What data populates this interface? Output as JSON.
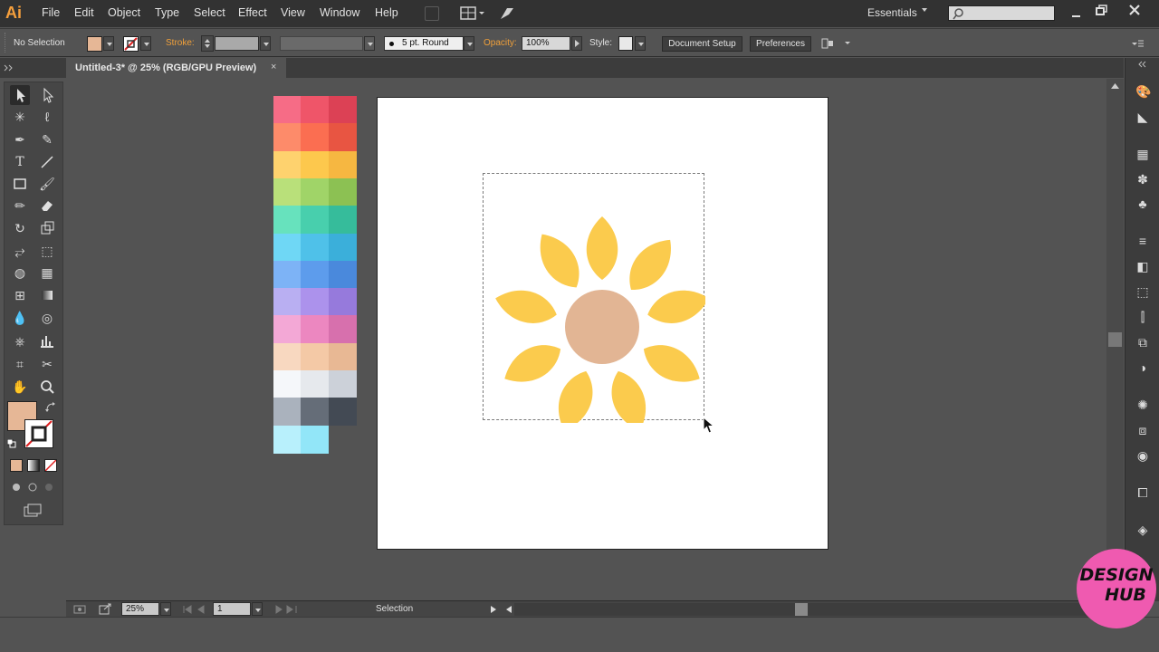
{
  "app": {
    "logo": "Ai"
  },
  "menu": [
    "File",
    "Edit",
    "Object",
    "Type",
    "Select",
    "Effect",
    "View",
    "Window",
    "Help"
  ],
  "workspace": {
    "label": "Essentials"
  },
  "control_bar": {
    "selection": "No Selection",
    "stroke_label": "Stroke:",
    "brush": "5 pt. Round",
    "opacity_label": "Opacity:",
    "opacity_value": "100%",
    "style_label": "Style:",
    "document_setup": "Document Setup",
    "preferences": "Preferences"
  },
  "tab": {
    "title": "Untitled-3* @ 25% (RGB/GPU Preview)",
    "close": "×"
  },
  "status": {
    "zoom": "25%",
    "page": "1",
    "tool": "Selection"
  },
  "badge": {
    "line1": "DESIGN",
    "line2": "HUB"
  },
  "colors": {
    "fill": "#e6b796",
    "petal": "#fbcb4d",
    "center": "#e2b594",
    "accent_orange": "#f0a03a",
    "badge": "#ef5ab0"
  },
  "swatches": [
    [
      "#f66c86",
      "#ef5569",
      "#dc4155"
    ],
    [
      "#fd8b6a",
      "#fb6e51",
      "#e85542"
    ],
    [
      "#fed26e",
      "#fdc84d",
      "#f6b741"
    ],
    [
      "#b9e07a",
      "#a0d468",
      "#8cc153"
    ],
    [
      "#67e2bd",
      "#48cfad",
      "#36bc9b"
    ],
    [
      "#6fd7f5",
      "#4fc1e9",
      "#3bafda"
    ],
    [
      "#7db3f6",
      "#5d9cec",
      "#4a89dc"
    ],
    [
      "#b9aff2",
      "#ac92ec",
      "#967adc"
    ],
    [
      "#f3a8d6",
      "#ec87c0",
      "#d770ad"
    ],
    [
      "#f8d8c0",
      "#f4c9a6",
      "#e8b894"
    ],
    [
      "#f5f7fa",
      "#e6e9ed",
      "#ccd1d9"
    ],
    [
      "#aab2bd",
      "#656d78",
      "#434a54"
    ],
    [
      "#b8f0fc",
      "#92e6f8"
    ]
  ]
}
